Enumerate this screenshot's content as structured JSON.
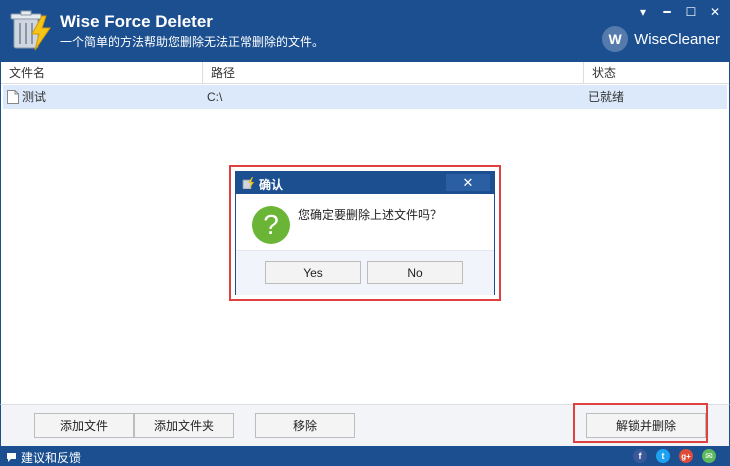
{
  "app": {
    "title": "Wise Force Deleter",
    "subtitle": "一个简单的方法帮助您删除无法正常删除的文件。",
    "brand": "WiseCleaner",
    "brand_initial": "W"
  },
  "window_controls": {
    "menu": "▾",
    "minimize": "━",
    "maximize": "☐",
    "close": "✕"
  },
  "table": {
    "columns": [
      "文件名",
      "路径",
      "状态"
    ],
    "rows": [
      {
        "name": "测试",
        "path": "C:\\",
        "status": "已就绪"
      }
    ]
  },
  "dialog": {
    "title": "确认",
    "close": "✕",
    "message": "您确定要删除上述文件吗？",
    "icon_glyph": "?",
    "yes": "Yes",
    "no": "No"
  },
  "toolbar": {
    "add_file": "添加文件",
    "add_folder": "添加文件夹",
    "remove": "移除",
    "unlock_delete": "解锁并删除"
  },
  "statusbar": {
    "feedback": "建议和反馈",
    "social": [
      {
        "icon": "facebook-icon",
        "glyph": "f",
        "color": "#3b5998"
      },
      {
        "icon": "twitter-icon",
        "glyph": "t",
        "color": "#1da1f2"
      },
      {
        "icon": "googleplus-icon",
        "glyph": "g+",
        "color": "#dd4b39"
      },
      {
        "icon": "email-icon",
        "glyph": "✉",
        "color": "#5cb85c"
      }
    ]
  },
  "colors": {
    "header": "#1b4f90",
    "row_selected": "#dbe9fb",
    "highlight": "#e04040",
    "question": "#6ab535"
  }
}
